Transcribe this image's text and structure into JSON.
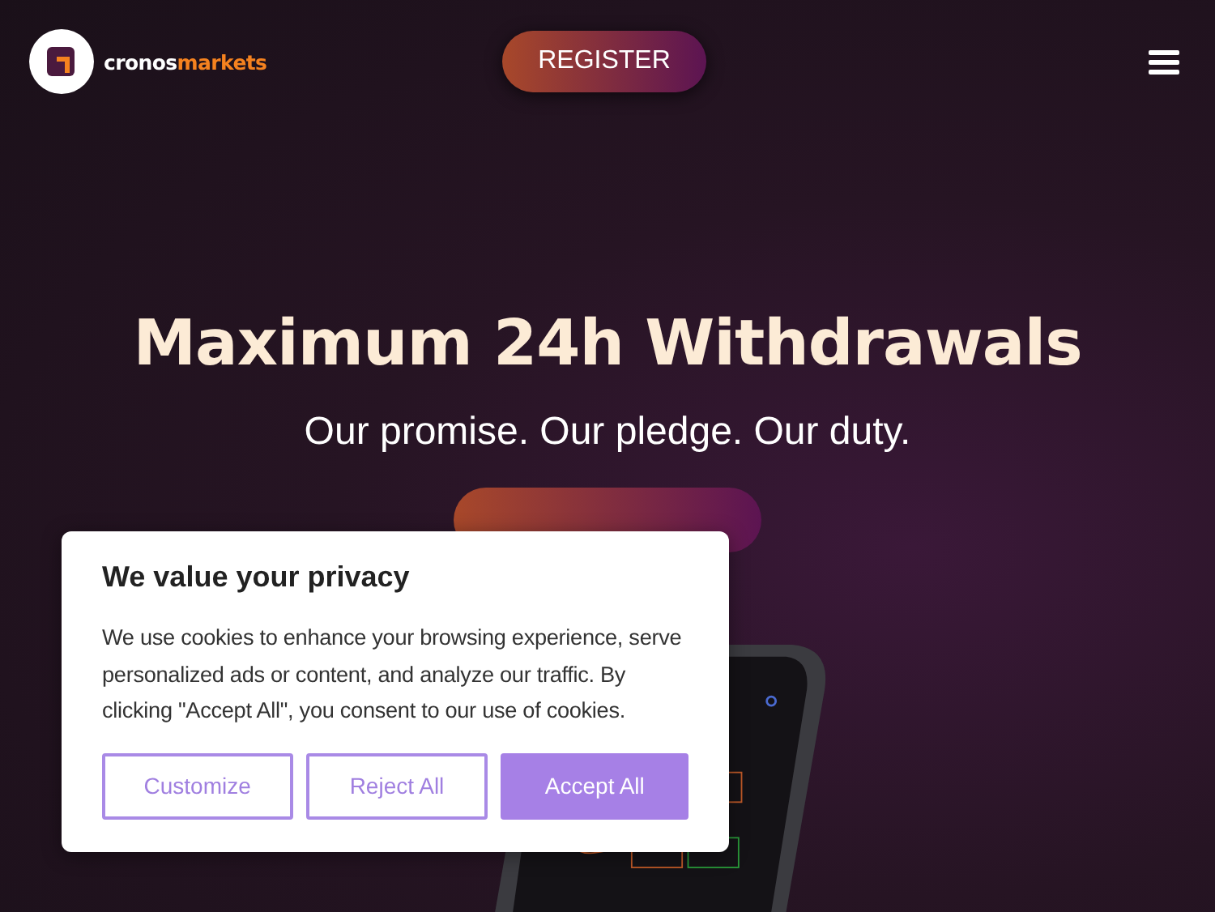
{
  "header": {
    "brand": {
      "first": "cronos",
      "second": "markets"
    },
    "register_button": "REGISTER"
  },
  "hero": {
    "title": "Maximum 24h Withdrawals",
    "subtitle": "Our promise. Our pledge. Our duty."
  },
  "cookie_dialog": {
    "title": "We value your privacy",
    "text": "We use cookies to enhance your browsing experience, serve personalized ads or content, and analyze our traffic. By clicking \"Accept All\", you consent to our use of cookies.",
    "buttons": [
      {
        "label": "Customize",
        "kind": "outline"
      },
      {
        "label": "Reject All",
        "kind": "outline"
      },
      {
        "label": "Accept All",
        "kind": "filled"
      }
    ]
  }
}
